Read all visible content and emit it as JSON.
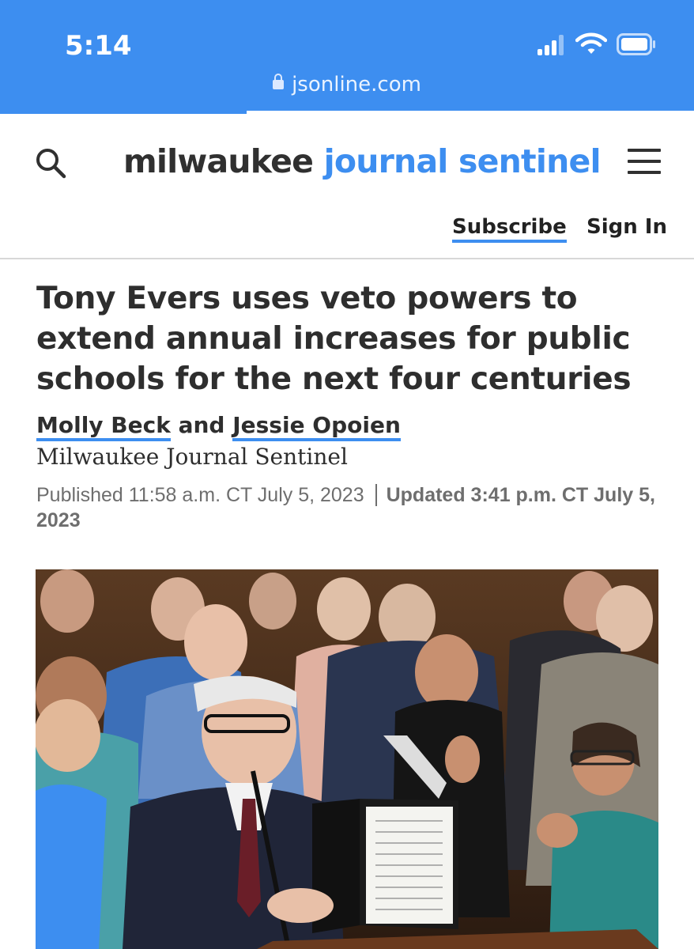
{
  "status_bar": {
    "time": "5:14",
    "url": "jsonline.com"
  },
  "header": {
    "brand_part1": "milwaukee ",
    "brand_part2": "journal sentinel",
    "subscribe_label": "Subscribe",
    "signin_label": "Sign In"
  },
  "article": {
    "headline": "Tony Evers uses veto powers to extend annual increases for public schools for the next four centuries",
    "author1": "Molly Beck",
    "authors_joiner": " and ",
    "author2": "Jessie Opoien",
    "organization": "Milwaukee Journal Sentinel",
    "published": "Published 11:58 a.m. CT July 5, 2023",
    "updated": "Updated 3:41 p.m. CT July 5, 2023"
  },
  "colors": {
    "accent": "#3d8ef0",
    "text": "#2e2e2e",
    "muted": "#6e6e6e"
  },
  "icons": [
    "lock-icon",
    "signal-icon",
    "wifi-icon",
    "battery-icon",
    "search-icon",
    "menu-icon"
  ]
}
